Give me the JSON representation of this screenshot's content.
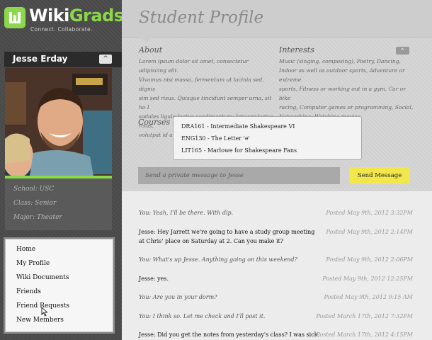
{
  "app": {
    "logo_name_part1": "Wiki",
    "logo_name_part2": "Grads",
    "tagline": "Connect. Collaborate."
  },
  "profile": {
    "name": "Jesse Erday",
    "collapse_symbol": "^",
    "school": "School:  USC",
    "class": "Class:  Senior",
    "major": "Major:  Theater"
  },
  "nav": {
    "items": [
      {
        "label": "Home"
      },
      {
        "label": "My Profile"
      },
      {
        "label": "Wiki Documents"
      },
      {
        "label": "Friends"
      },
      {
        "label": "Friend Requests"
      },
      {
        "label": "New Members"
      }
    ]
  },
  "main": {
    "title": "Student Profile",
    "about": {
      "heading": "About",
      "lines": [
        "Lorem ipsum dolor sit amet, consectetur adipiscing elit.",
        "Vivamus nisi massa, fermentum ut lacinia sed, dignis",
        "sim sed risus. Quisque tincidunt semper urna, sit ho I",
        "sodales ligula luctus condimentum. Integer lectus risus,",
        "volutpat id auctor sed, pretium eget erat."
      ]
    },
    "interests": {
      "heading": "Interests",
      "lines": [
        "Music (singing, composing),  Poetry,  Dancing,",
        "Indoor as well as outdoor sports,  Adventure or extreme",
        "sports,  Fitness or working out in a gym,  Car or bike",
        "racing,  Computer games or programming,  Social,",
        "Networking,  Watching movies."
      ],
      "toggle_symbol": "^"
    },
    "courses": {
      "heading": "Courses",
      "items": [
        "DRA161 - Intermediate Shakespeare VI",
        "ENG130 - The Letter 'e'",
        "LIT165 - Marlowe for Shakespeare Fans"
      ]
    },
    "message_box": {
      "placeholder": "Send a private message to Jesse",
      "send_label": "Send Message"
    }
  },
  "messages": [
    {
      "sender": "you",
      "text": "You:  Yeah, I'll be there.  With dip.",
      "time": "Posted May 9th, 2012 3:32PM"
    },
    {
      "sender": "jesse",
      "text": "Jesse: Hey Jarrett we're going to have a study group meeting at Chris' place on Saturday at 2.  Can you make it?",
      "time": "Posted May 9th, 2012 2:14PM"
    },
    {
      "sender": "you",
      "text": "You: What's up Jesse.  Anything going on this weekend?",
      "time": "Posted May 9th, 2012 2:06PM"
    },
    {
      "sender": "jesse",
      "text": "Jesse: yes.",
      "time": "Posted May 9th, 2012 12:25PM"
    },
    {
      "sender": "you",
      "text": "You: Are you in your dorm?",
      "time": "Posted May 9th, 2012 9:15 AM"
    },
    {
      "sender": "you",
      "text": "You: I think so.  Let me check and I'll post it.",
      "time": "Posted March 17th, 2012 7:32PM"
    },
    {
      "sender": "jesse",
      "text": "Jesse: Did you get the notes from yesterday's class?  I was sick.",
      "time": "Posted March 17th, 2012 4:15PM"
    }
  ],
  "colors": {
    "accent_green": "#8bd84a",
    "send_button": "#f1e64b",
    "sidebar_bg": "#4a4a4a"
  }
}
